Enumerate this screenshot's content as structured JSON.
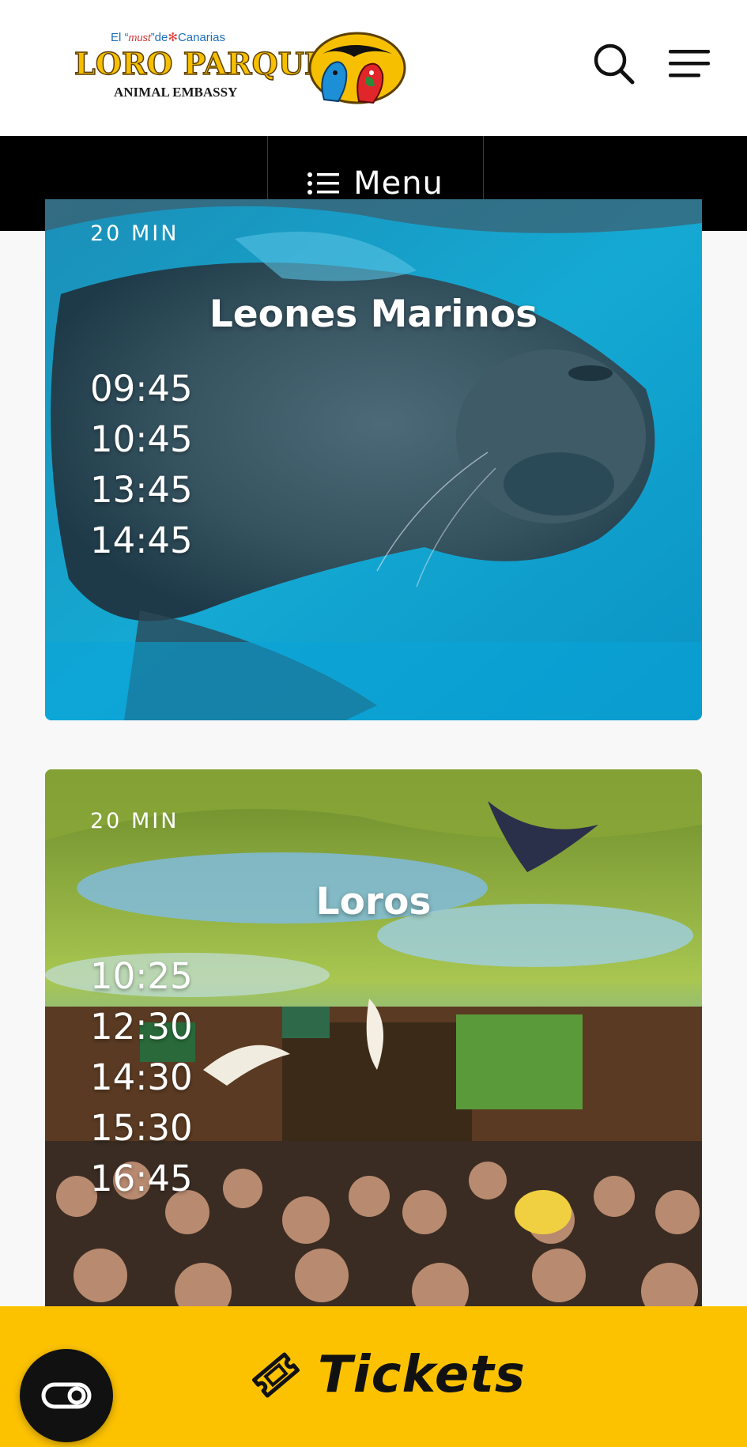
{
  "header": {
    "logo": {
      "tag_prefix": "El “",
      "tag_must": "must",
      "tag_middle": "”de",
      "tag_suffix": "Canarias",
      "name": "LORO PARQUE",
      "subtitle": "ANIMAL EMBASSY"
    },
    "icons": {
      "search": "search-icon",
      "menu": "hamburger-menu-icon"
    }
  },
  "menubar": {
    "label": "Menu",
    "icon": "list-icon"
  },
  "shows": [
    {
      "duration": "20 MIN",
      "title": "Leones Marinos",
      "times": [
        "09:45",
        "10:45",
        "13:45",
        "14:45"
      ],
      "accent": "#17a6cf"
    },
    {
      "duration": "20 MIN",
      "title": "Loros",
      "times": [
        "10:25",
        "12:30",
        "14:30",
        "15:30",
        "16:45"
      ],
      "accent": "#5b7a2a"
    }
  ],
  "tickets": {
    "label": "Tickets",
    "icon": "ticket-icon",
    "color": "#fcc200"
  },
  "accessibility": {
    "icon": "accessibility-toggle-icon"
  }
}
